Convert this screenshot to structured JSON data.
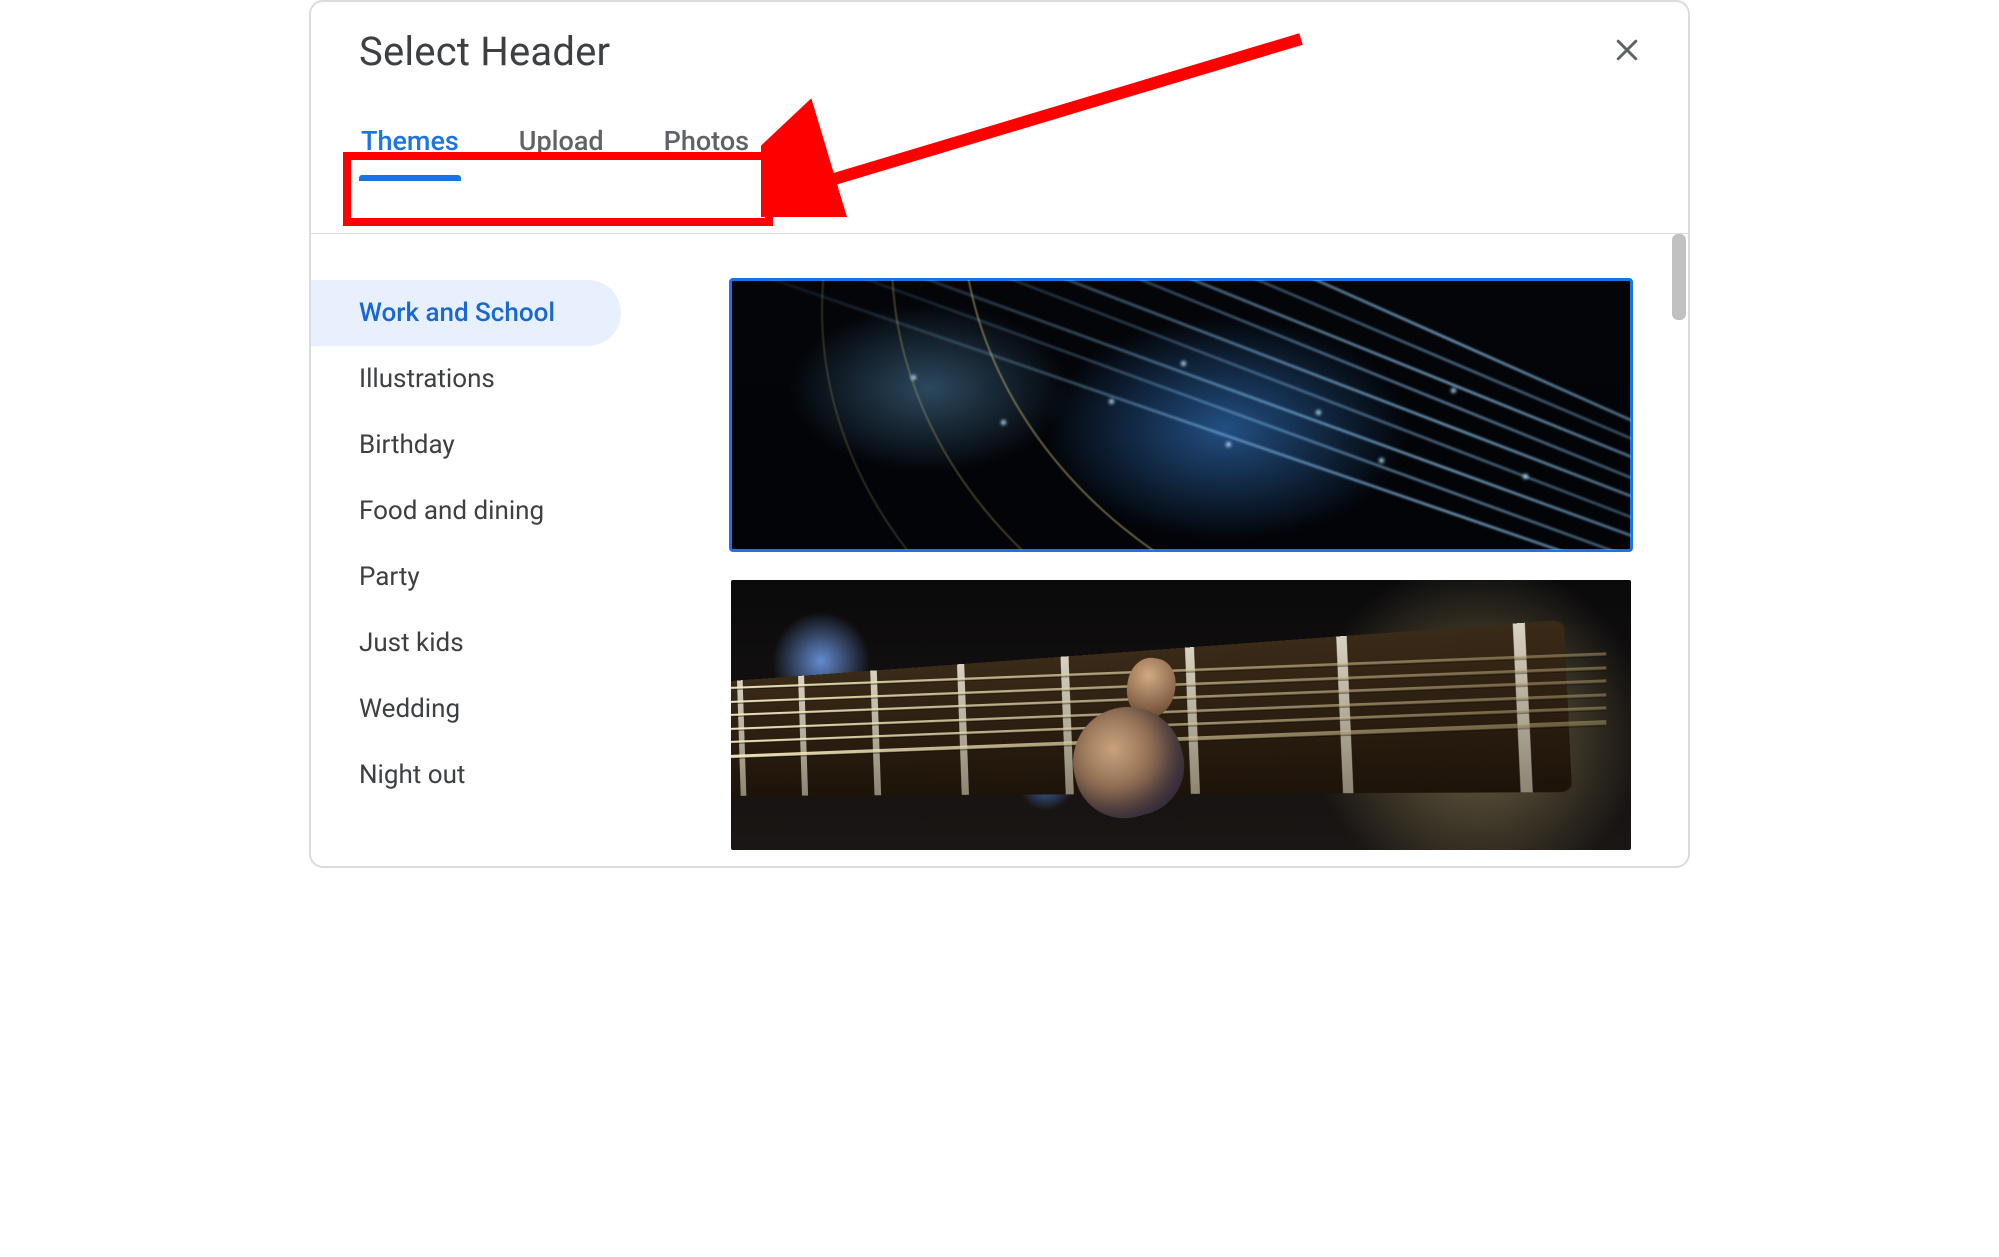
{
  "dialog": {
    "title": "Select Header"
  },
  "tabs": [
    {
      "label": "Themes",
      "active": true
    },
    {
      "label": "Upload",
      "active": false
    },
    {
      "label": "Photos",
      "active": false
    }
  ],
  "categories": [
    {
      "label": "Work and School",
      "selected": true
    },
    {
      "label": "Illustrations",
      "selected": false
    },
    {
      "label": "Birthday",
      "selected": false
    },
    {
      "label": "Food and dining",
      "selected": false
    },
    {
      "label": "Party",
      "selected": false
    },
    {
      "label": "Just kids",
      "selected": false
    },
    {
      "label": "Wedding",
      "selected": false
    },
    {
      "label": "Night out",
      "selected": false
    }
  ],
  "thumbnails": [
    {
      "name": "fiber-optics-blue",
      "selected": true
    },
    {
      "name": "guitar-bokeh",
      "selected": false
    }
  ],
  "annotation": {
    "highlight_target": "tabs",
    "arrow_color": "#ff0000"
  }
}
